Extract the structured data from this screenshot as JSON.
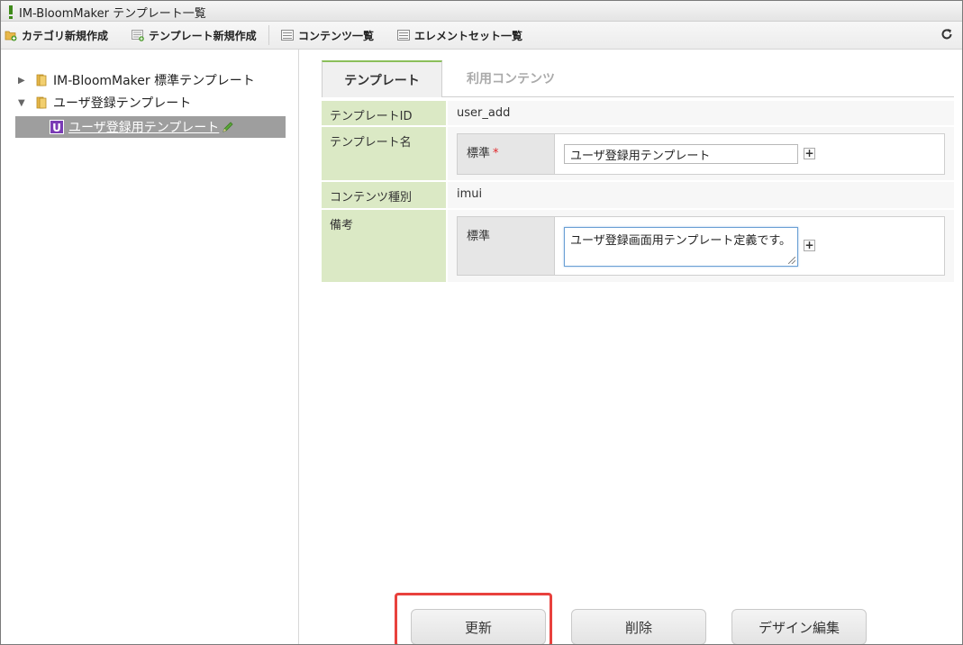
{
  "window": {
    "title": "IM-BloomMaker テンプレート一覧"
  },
  "toolbar": {
    "new_category": "カテゴリ新規作成",
    "new_template": "テンプレート新規作成",
    "content_list": "コンテンツ一覧",
    "elementset_list": "エレメントセット一覧"
  },
  "tree": {
    "nodes": [
      {
        "label": "IM-BloomMaker 標準テンプレート",
        "expanded": false
      },
      {
        "label": "ユーザ登録テンプレート",
        "expanded": true
      }
    ],
    "selected": {
      "badge": "U",
      "label": "ユーザ登録用テンプレート"
    }
  },
  "tabs": [
    {
      "label": "テンプレート",
      "active": true
    },
    {
      "label": "利用コンテンツ",
      "active": false
    }
  ],
  "form": {
    "template_id": {
      "label": "テンプレートID",
      "value": "user_add"
    },
    "template_name": {
      "label": "テンプレート名",
      "locale_label": "標準",
      "required_mark": "*",
      "value": "ユーザ登録用テンプレート"
    },
    "content_type": {
      "label": "コンテンツ種別",
      "value": "imui"
    },
    "remarks": {
      "label": "備考",
      "locale_label": "標準",
      "value": "ユーザ登録画面用テンプレート定義です。"
    },
    "plus_symbol": "+"
  },
  "buttons": {
    "update": "更新",
    "delete": "削除",
    "design_edit": "デザイン編集"
  },
  "colors": {
    "label_bg": "#dbe9c5",
    "selected_bg": "#9e9e9e",
    "badge_bg": "#7a3bb5",
    "highlight": "#e8413d",
    "tab_accent": "#8bbf5a"
  }
}
